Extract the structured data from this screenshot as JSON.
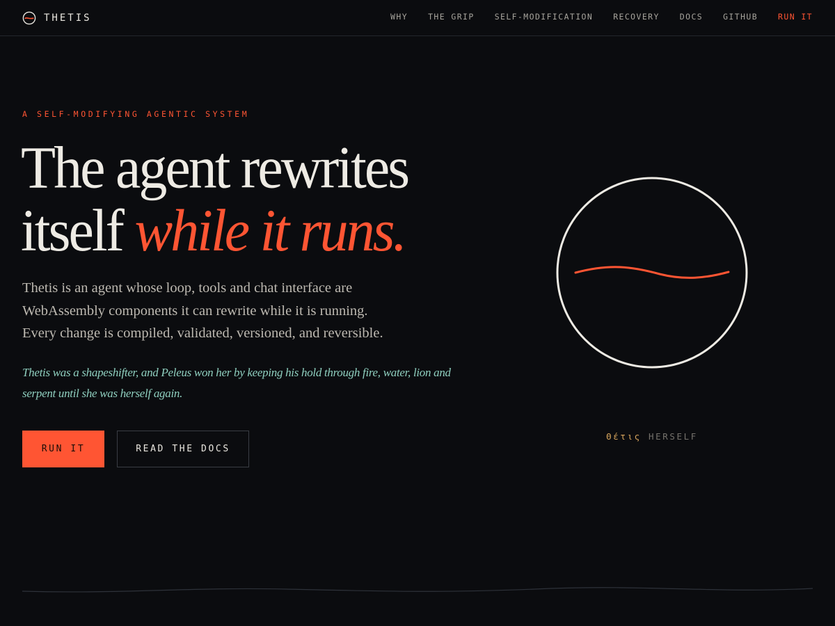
{
  "header": {
    "brand_name": "THETIS",
    "nav": [
      {
        "label": "WHY"
      },
      {
        "label": "THE GRIP"
      },
      {
        "label": "SELF-MODIFICATION"
      },
      {
        "label": "RECOVERY"
      },
      {
        "label": "DOCS"
      },
      {
        "label": "GITHUB"
      },
      {
        "label": "RUN IT"
      }
    ]
  },
  "hero": {
    "eyebrow": "A SELF-MODIFYING AGENTIC SYSTEM",
    "headline_line1": "The agent rewrites",
    "headline_line2_plain": "itself ",
    "headline_line2_accent": "while it runs.",
    "lede_lines": [
      "Thetis is an agent whose loop, tools and chat interface are",
      "WebAssembly components it can rewrite while it is running.",
      "Every change is compiled, validated, versioned, and reversible."
    ],
    "myth_lines": [
      "Thetis was a shapeshifter, and Peleus won her by keeping his hold through fire, water, lion and",
      "serpent until she was herself again."
    ],
    "primary_cta": "RUN IT",
    "secondary_cta": "READ THE DOCS"
  },
  "emblem": {
    "caption_greek": "Θέτις",
    "caption_text": "HERSELF"
  },
  "icons": {
    "brand_logo": "circle-wave-logo-icon",
    "emblem": "circle-wave-emblem-icon",
    "divider": "wave-divider"
  },
  "colors": {
    "background": "#0b0c0f",
    "accent": "#ff5533",
    "text": "#eeebe4",
    "muted": "#bdb9b1",
    "myth_teal": "#8fcfbf",
    "greek_gold": "#d6a45c"
  }
}
